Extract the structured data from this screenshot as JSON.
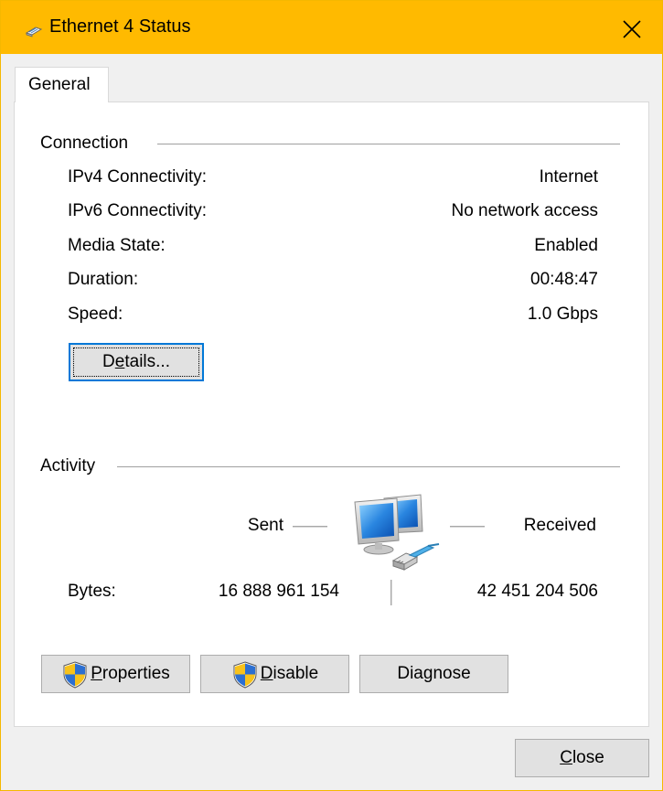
{
  "window": {
    "title": "Ethernet 4 Status",
    "accent": "#ffba00"
  },
  "tabs": [
    {
      "label": "General"
    }
  ],
  "connection": {
    "heading": "Connection",
    "rows": [
      {
        "label": "IPv4 Connectivity:",
        "value": "Internet"
      },
      {
        "label": "IPv6 Connectivity:",
        "value": "No network access"
      },
      {
        "label": "Media State:",
        "value": "Enabled"
      },
      {
        "label": "Duration:",
        "value": "00:48:47"
      },
      {
        "label": "Speed:",
        "value": "1.0 Gbps"
      }
    ],
    "details_button": {
      "label": "Details...",
      "mnemonic": "e"
    }
  },
  "activity": {
    "heading": "Activity",
    "sent_label": "Sent",
    "received_label": "Received",
    "bytes_label": "Bytes:",
    "bytes_sent": "16 888 961 154",
    "bytes_received": "42 451 204 506",
    "icon": "network-computers-icon"
  },
  "actions": {
    "properties": {
      "label": "Properties",
      "mnemonic": "P",
      "icon": "uac-shield-icon"
    },
    "disable": {
      "label": "Disable",
      "mnemonic": "D",
      "icon": "uac-shield-icon"
    },
    "diagnose": {
      "label": "Diagnose",
      "mnemonic": "g"
    }
  },
  "footer": {
    "close_button": {
      "label": "Close",
      "mnemonic": "C"
    }
  }
}
